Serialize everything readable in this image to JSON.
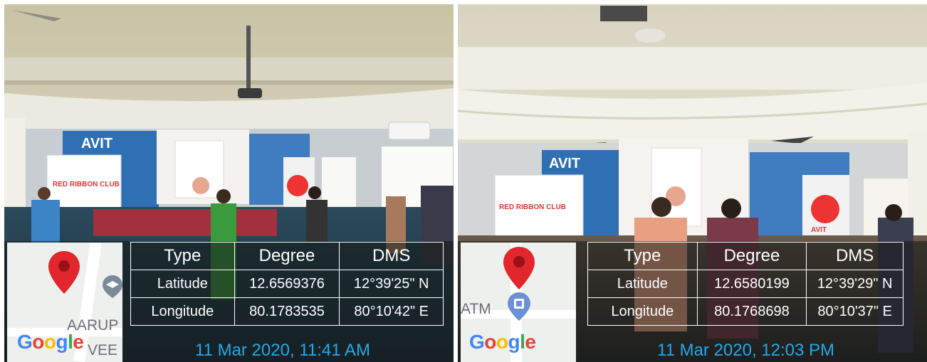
{
  "photos": [
    {
      "map": {
        "poi_labels": [
          "AARUP",
          "VEE"
        ],
        "logo_letters": [
          "G",
          "o",
          "o",
          "g",
          "l",
          "e"
        ]
      },
      "gps_table": {
        "headers": [
          "Type",
          "Degree",
          "DMS"
        ],
        "rows": [
          {
            "type": "Latitude",
            "degree": "12.6569376",
            "dms": "12°39'25\" N"
          },
          {
            "type": "Longitude",
            "degree": "80.1783535",
            "dms": "80°10'42\" E"
          }
        ]
      },
      "timestamp": "11 Mar 2020, 11:41 AM",
      "scene_text": {
        "banner_left": "AVIT",
        "banner_club": "RED RIBBON CLUB"
      }
    },
    {
      "map": {
        "poi_labels": [
          "ATM"
        ],
        "logo_letters": [
          "G",
          "o",
          "o",
          "g",
          "l",
          "e"
        ]
      },
      "gps_table": {
        "headers": [
          "Type",
          "Degree",
          "DMS"
        ],
        "rows": [
          {
            "type": "Latitude",
            "degree": "12.6580199",
            "dms": "12°39'29\" N"
          },
          {
            "type": "Longitude",
            "degree": "80.1768698",
            "dms": "80°10'37\" E"
          }
        ]
      },
      "timestamp": "11 Mar 2020, 12:03 PM",
      "scene_text": {
        "banner_left": "AVIT",
        "banner_club": "RED RIBBON CLUB",
        "banner_right": "AVIT"
      }
    }
  ],
  "colors": {
    "timestamp": "#24a8ea",
    "pin": "#e1262c",
    "google_blue": "#4285f4",
    "google_red": "#ea4335",
    "google_yellow": "#fbbc05",
    "google_green": "#34a853"
  }
}
